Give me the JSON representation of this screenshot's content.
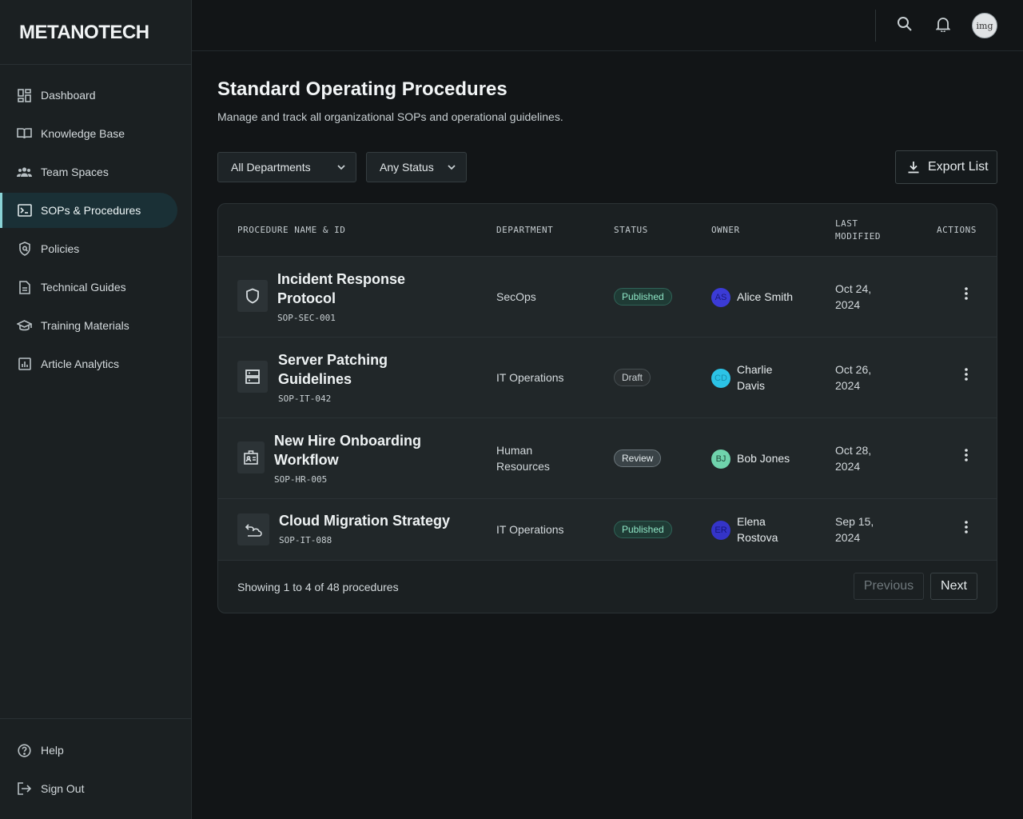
{
  "app": {
    "brand": "METANOTECH"
  },
  "sidebar": {
    "items": [
      {
        "label": "Dashboard",
        "icon": "dashboard-icon"
      },
      {
        "label": "Knowledge Base",
        "icon": "book-icon"
      },
      {
        "label": "Team Spaces",
        "icon": "team-icon"
      },
      {
        "label": "SOPs & Procedures",
        "icon": "terminal-icon",
        "active": true
      },
      {
        "label": "Policies",
        "icon": "policy-shield-icon"
      },
      {
        "label": "Technical Guides",
        "icon": "document-icon"
      },
      {
        "label": "Training Materials",
        "icon": "graduation-cap-icon"
      },
      {
        "label": "Article Analytics",
        "icon": "analytics-icon"
      }
    ],
    "footer": [
      {
        "label": "Help",
        "icon": "help-icon"
      },
      {
        "label": "Sign Out",
        "icon": "sign-out-icon"
      }
    ]
  },
  "header": {
    "avatar_text": "img"
  },
  "page": {
    "title": "Standard Operating Procedures",
    "subtitle": "Manage and track all organizational SOPs and operational guidelines."
  },
  "filters": {
    "department": "All Departments",
    "status": "Any Status",
    "export_label": "Export List"
  },
  "table": {
    "columns": {
      "name": "PROCEDURE NAME & ID",
      "department": "DEPARTMENT",
      "status": "STATUS",
      "owner": "OWNER",
      "modified_1": "LAST",
      "modified_2": "MODIFIED",
      "actions": "ACTIONS"
    },
    "rows": [
      {
        "name_1": "Incident Response",
        "name_2": "Protocol",
        "id": "SOP-SEC-001",
        "icon": "shield-icon",
        "department_1": "SecOps",
        "department_2": "",
        "status": "Published",
        "owner_initials": "AS",
        "owner_1": "Alice Smith",
        "owner_2": "",
        "date_1": "Oct 24,",
        "date_2": "2024"
      },
      {
        "name_1": "Server Patching",
        "name_2": "Guidelines",
        "id": "SOP-IT-042",
        "icon": "server-icon",
        "department_1": "IT Operations",
        "department_2": "",
        "status": "Draft",
        "owner_initials": "CD",
        "owner_1": "Charlie",
        "owner_2": "Davis",
        "date_1": "Oct 26,",
        "date_2": "2024"
      },
      {
        "name_1": "New Hire Onboarding",
        "name_2": "Workflow",
        "id": "SOP-HR-005",
        "icon": "badge-icon",
        "department_1": "Human",
        "department_2": "Resources",
        "status": "Review",
        "owner_initials": "BJ",
        "owner_1": "Bob Jones",
        "owner_2": "",
        "date_1": "Oct 28,",
        "date_2": "2024"
      },
      {
        "name_1": "Cloud Migration Strategy",
        "name_2": "",
        "id": "SOP-IT-088",
        "icon": "cloud-migrate-icon",
        "department_1": "IT Operations",
        "department_2": "",
        "status": "Published",
        "owner_initials": "ER",
        "owner_1": "Elena",
        "owner_2": "Rostova",
        "date_1": "Sep 15,",
        "date_2": "2024"
      }
    ],
    "footer": {
      "showing": "Showing 1 to 4 of 48 procedures",
      "prev": "Previous",
      "next": "Next"
    }
  },
  "colors": {
    "accent": "#8ad3d6",
    "published": "#8fe6c6",
    "avatar_as": "#3b3bd6",
    "avatar_cd": "#2cc3e6",
    "avatar_bj": "#6fd3ac",
    "avatar_er": "#3434c8"
  }
}
